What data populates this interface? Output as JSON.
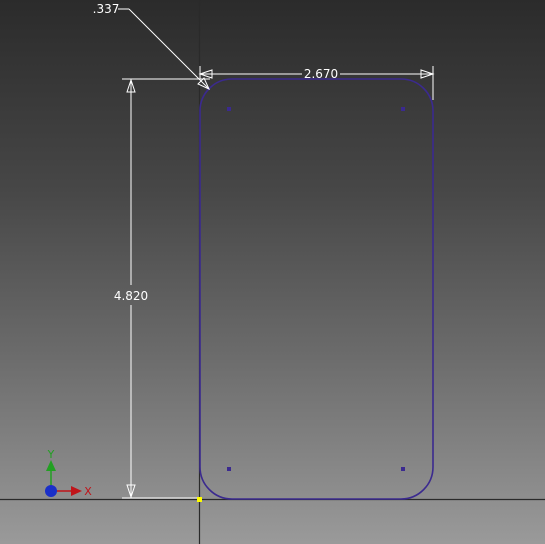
{
  "dimensions": {
    "width_label": "2.670",
    "height_label": "4.820",
    "radius_label": ".337"
  },
  "triad": {
    "x_label": "X",
    "y_label": "Y"
  },
  "colors": {
    "sketch_line": "#3b2a8f",
    "dimension_line": "#ffffff",
    "axis_x": "#c0141a",
    "axis_y": "#22a022",
    "origin": "#1a2fc8",
    "origin_point": "#ffff00"
  }
}
